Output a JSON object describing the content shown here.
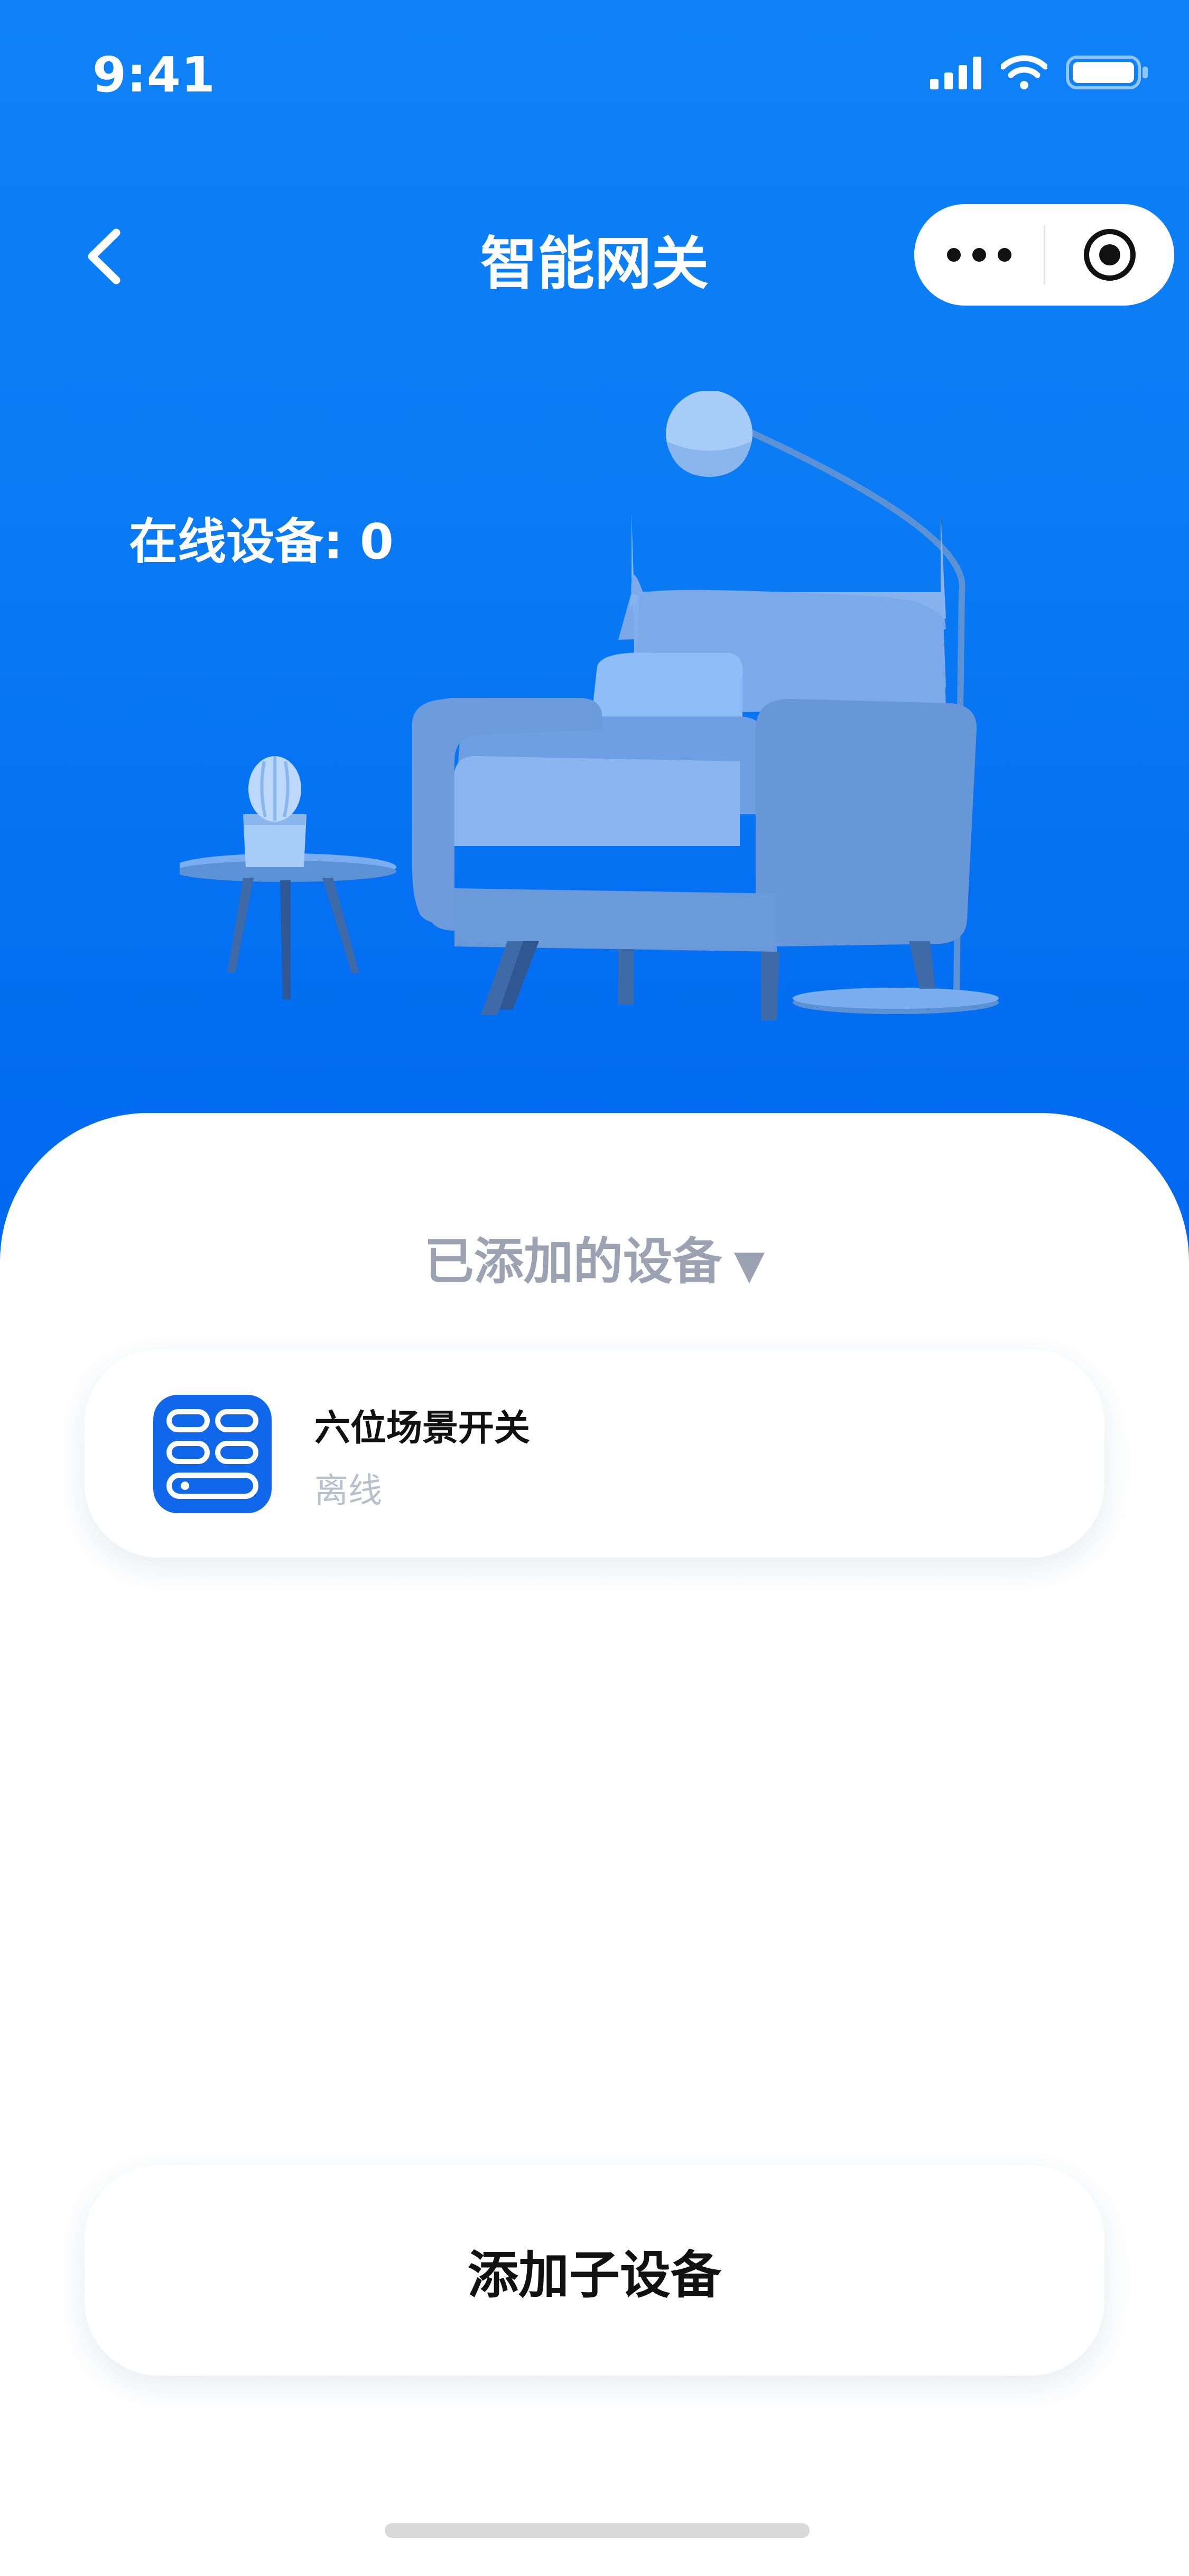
{
  "status_bar": {
    "time": "9:41"
  },
  "nav": {
    "title": "智能网关"
  },
  "summary": {
    "online_devices": "在线设备: 0"
  },
  "devices": {
    "section_label": "已添加的设备",
    "section_arrow": "▼",
    "items": [
      {
        "name": "六位场景开关",
        "status": "离线"
      }
    ]
  },
  "actions": {
    "add_subdevice": "添加子设备"
  },
  "colors": {
    "primary": "#0a7bf4",
    "muted": "#9ba3b3",
    "status_offline": "#b6bfcc"
  }
}
